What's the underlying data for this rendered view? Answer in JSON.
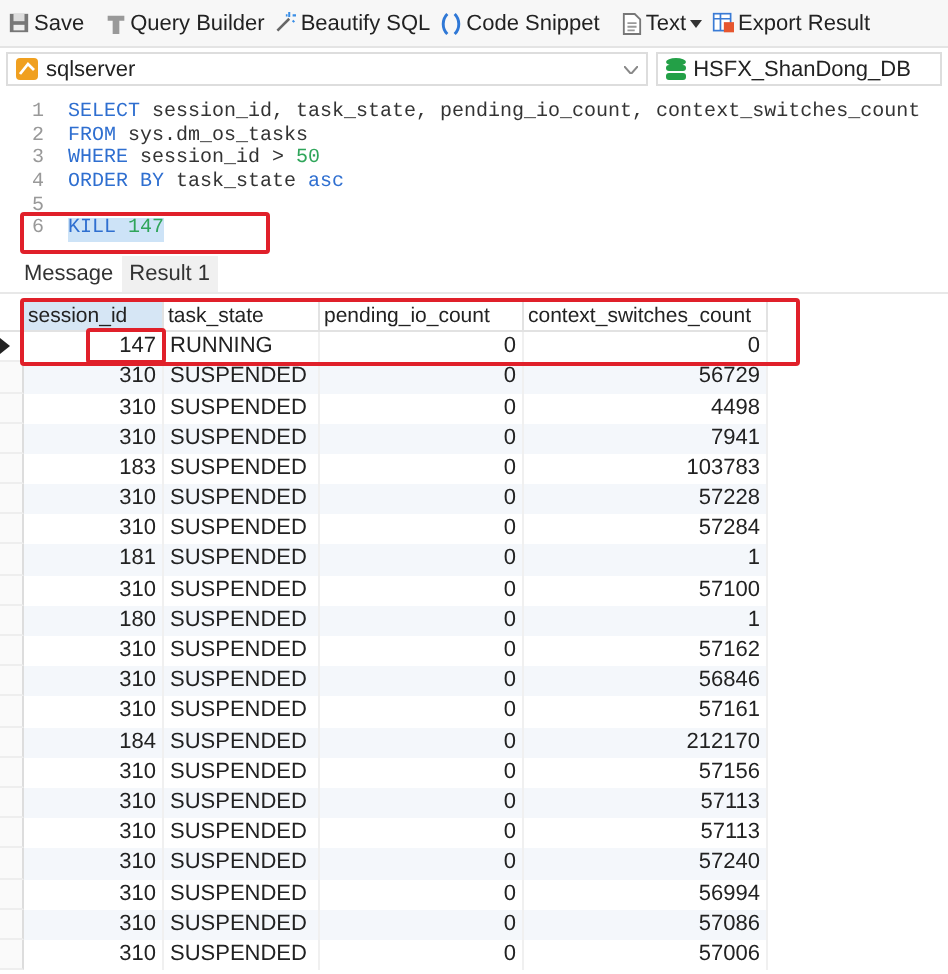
{
  "toolbar": [
    {
      "label": "Save"
    },
    {
      "label": "Query Builder"
    },
    {
      "label": "Beautify SQL"
    },
    {
      "label": "Code Snippet"
    },
    {
      "label": "Text"
    },
    {
      "label": "Export Result"
    }
  ],
  "connection": {
    "name": "sqlserver",
    "database": "HSFX_ShanDong_DB"
  },
  "editor": {
    "lines": [
      {
        "number": "1",
        "selected": false,
        "tokens": [
          {
            "kind": "keyword",
            "text": "SELECT"
          },
          {
            "kind": "ident",
            "text": " session_id, task_state, pending_io_count, context_switches_count"
          }
        ]
      },
      {
        "number": "2",
        "selected": false,
        "tokens": [
          {
            "kind": "keyword",
            "text": "FROM"
          },
          {
            "kind": "ident",
            "text": " sys.dm_os_tasks"
          }
        ]
      },
      {
        "number": "3",
        "selected": false,
        "tokens": [
          {
            "kind": "keyword",
            "text": "WHERE"
          },
          {
            "kind": "ident",
            "text": " session_id > "
          },
          {
            "kind": "number",
            "text": "50"
          }
        ]
      },
      {
        "number": "4",
        "selected": false,
        "tokens": [
          {
            "kind": "keyword",
            "text": "ORDER BY"
          },
          {
            "kind": "ident",
            "text": " task_state "
          },
          {
            "kind": "keyword",
            "text": "asc"
          }
        ]
      },
      {
        "number": "5"
      },
      {
        "number": "6",
        "selected": true,
        "tokens": [
          {
            "kind": "keyword",
            "text": "KILL"
          },
          {
            "kind": "number",
            "text": " 147"
          }
        ]
      }
    ]
  },
  "result_tabs": [
    {
      "label": "Message",
      "selected": false
    },
    {
      "label": "Result 1",
      "selected": true
    }
  ],
  "table": {
    "columns": [
      "session_id",
      "task_state",
      "pending_io_count",
      "context_switches_count"
    ],
    "rows": [
      {
        "selected": true,
        "cells": [
          "147",
          "RUNNING",
          "0",
          "0"
        ]
      },
      {
        "selected": false,
        "cells": [
          "310",
          "SUSPENDED",
          "0",
          "56729"
        ]
      },
      {
        "selected": false,
        "cells": [
          "310",
          "SUSPENDED",
          "0",
          "4498"
        ]
      },
      {
        "selected": false,
        "cells": [
          "310",
          "SUSPENDED",
          "0",
          "7941"
        ]
      },
      {
        "selected": false,
        "cells": [
          "183",
          "SUSPENDED",
          "0",
          "103783"
        ]
      },
      {
        "selected": false,
        "cells": [
          "310",
          "SUSPENDED",
          "0",
          "57228"
        ]
      },
      {
        "selected": false,
        "cells": [
          "310",
          "SUSPENDED",
          "0",
          "57284"
        ]
      },
      {
        "selected": false,
        "cells": [
          "181",
          "SUSPENDED",
          "0",
          "1"
        ]
      },
      {
        "selected": false,
        "cells": [
          "310",
          "SUSPENDED",
          "0",
          "57100"
        ]
      },
      {
        "selected": false,
        "cells": [
          "180",
          "SUSPENDED",
          "0",
          "1"
        ]
      },
      {
        "selected": false,
        "cells": [
          "310",
          "SUSPENDED",
          "0",
          "57162"
        ]
      },
      {
        "selected": false,
        "cells": [
          "310",
          "SUSPENDED",
          "0",
          "56846"
        ]
      },
      {
        "selected": false,
        "cells": [
          "310",
          "SUSPENDED",
          "0",
          "57161"
        ]
      },
      {
        "selected": false,
        "cells": [
          "184",
          "SUSPENDED",
          "0",
          "212170"
        ]
      },
      {
        "selected": false,
        "cells": [
          "310",
          "SUSPENDED",
          "0",
          "57156"
        ]
      },
      {
        "selected": false,
        "cells": [
          "310",
          "SUSPENDED",
          "0",
          "57113"
        ]
      },
      {
        "selected": false,
        "cells": [
          "310",
          "SUSPENDED",
          "0",
          "57113"
        ]
      },
      {
        "selected": false,
        "cells": [
          "310",
          "SUSPENDED",
          "0",
          "57240"
        ]
      },
      {
        "selected": false,
        "cells": [
          "310",
          "SUSPENDED",
          "0",
          "56994"
        ]
      },
      {
        "selected": false,
        "cells": [
          "310",
          "SUSPENDED",
          "0",
          "57086"
        ]
      },
      {
        "selected": false,
        "cells": [
          "310",
          "SUSPENDED",
          "0",
          "57006"
        ]
      }
    ]
  }
}
